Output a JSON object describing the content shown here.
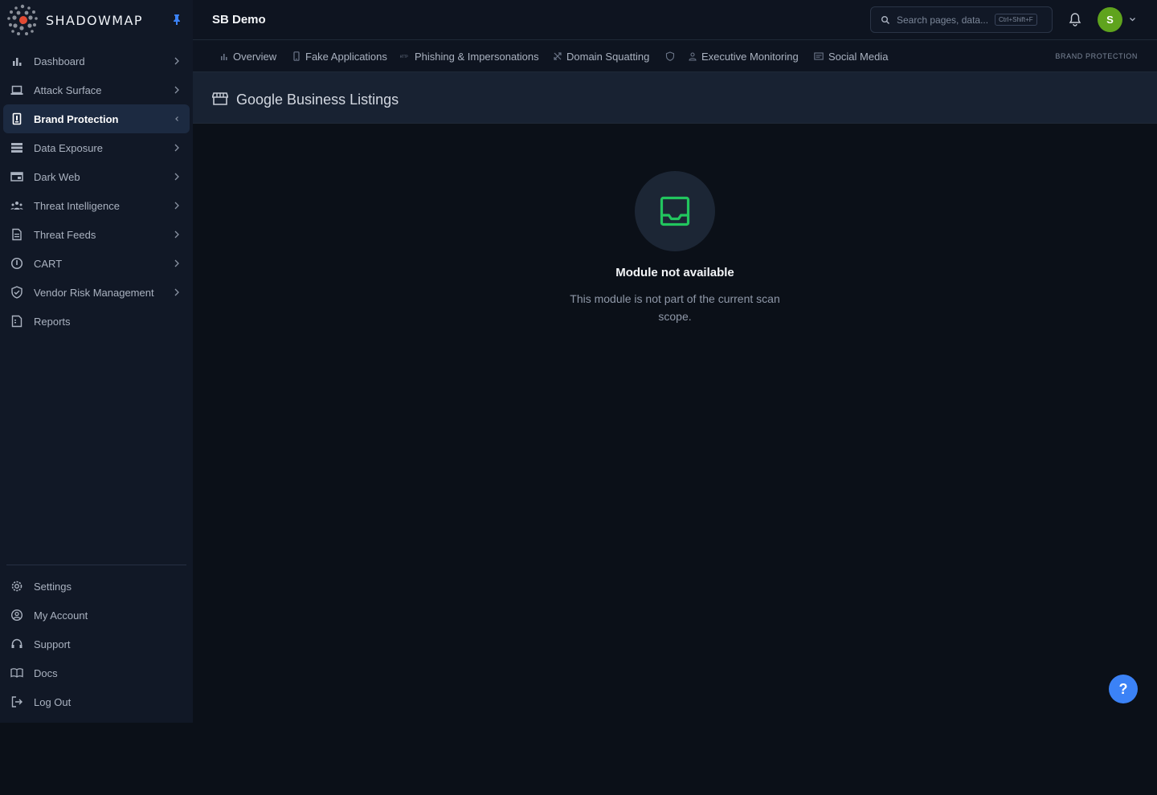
{
  "brand": {
    "name": "SHADOWMAP"
  },
  "sidebar": {
    "items": [
      {
        "label": "Dashboard",
        "icon": "bar-chart-icon",
        "has_chevron": true
      },
      {
        "label": "Attack Surface",
        "icon": "laptop-icon",
        "has_chevron": true
      },
      {
        "label": "Brand Protection",
        "icon": "id-badge-icon",
        "has_chevron": true,
        "active": true
      },
      {
        "label": "Data Exposure",
        "icon": "server-icon",
        "has_chevron": true
      },
      {
        "label": "Dark Web",
        "icon": "browser-window-icon",
        "has_chevron": true
      },
      {
        "label": "Threat Intelligence",
        "icon": "users-icon",
        "has_chevron": true
      },
      {
        "label": "Threat Feeds",
        "icon": "document-icon",
        "has_chevron": true
      },
      {
        "label": "CART",
        "icon": "alert-circle-icon",
        "has_chevron": true
      },
      {
        "label": "Vendor Risk Management",
        "icon": "shield-check-icon",
        "has_chevron": true
      },
      {
        "label": "Reports",
        "icon": "report-icon",
        "has_chevron": false
      }
    ],
    "bottom_items": [
      {
        "label": "Settings",
        "icon": "gear-icon"
      },
      {
        "label": "My Account",
        "icon": "user-circle-icon"
      },
      {
        "label": "Support",
        "icon": "headset-icon"
      },
      {
        "label": "Docs",
        "icon": "book-icon"
      },
      {
        "label": "Log Out",
        "icon": "logout-icon"
      }
    ]
  },
  "header": {
    "org_title": "SB Demo",
    "search_placeholder": "Search pages, data...",
    "search_shortcut": "Ctrl+Shift+F",
    "avatar_initial": "S"
  },
  "tabs": {
    "items": [
      {
        "label": "Overview",
        "icon": "bar-chart-icon"
      },
      {
        "label": "Fake Applications",
        "icon": "mobile-icon"
      },
      {
        "label": "Phishing & Impersonations",
        "icon": "http-icon"
      },
      {
        "label": "Domain Squatting",
        "icon": "crossed-arrows-icon"
      },
      {
        "label": "",
        "icon": "shield-icon"
      },
      {
        "label": "Executive Monitoring",
        "icon": "person-icon"
      },
      {
        "label": "Social Media",
        "icon": "message-box-icon"
      }
    ],
    "section_label": "BRAND PROTECTION"
  },
  "page": {
    "title": "Google Business Listings",
    "icon": "storefront-icon"
  },
  "empty_state": {
    "icon": "inbox-icon",
    "title": "Module not available",
    "description": "This module is not part of the current scan scope."
  },
  "help": {
    "label": "?"
  },
  "colors": {
    "sidebar_bg": "#111826",
    "main_bg": "#0b1018",
    "active_item_bg": "#1c2a41",
    "accent_green": "#22c55e",
    "avatar_green": "#5fa31d",
    "help_blue": "#3b82f6",
    "logo_red": "#e24a33"
  }
}
